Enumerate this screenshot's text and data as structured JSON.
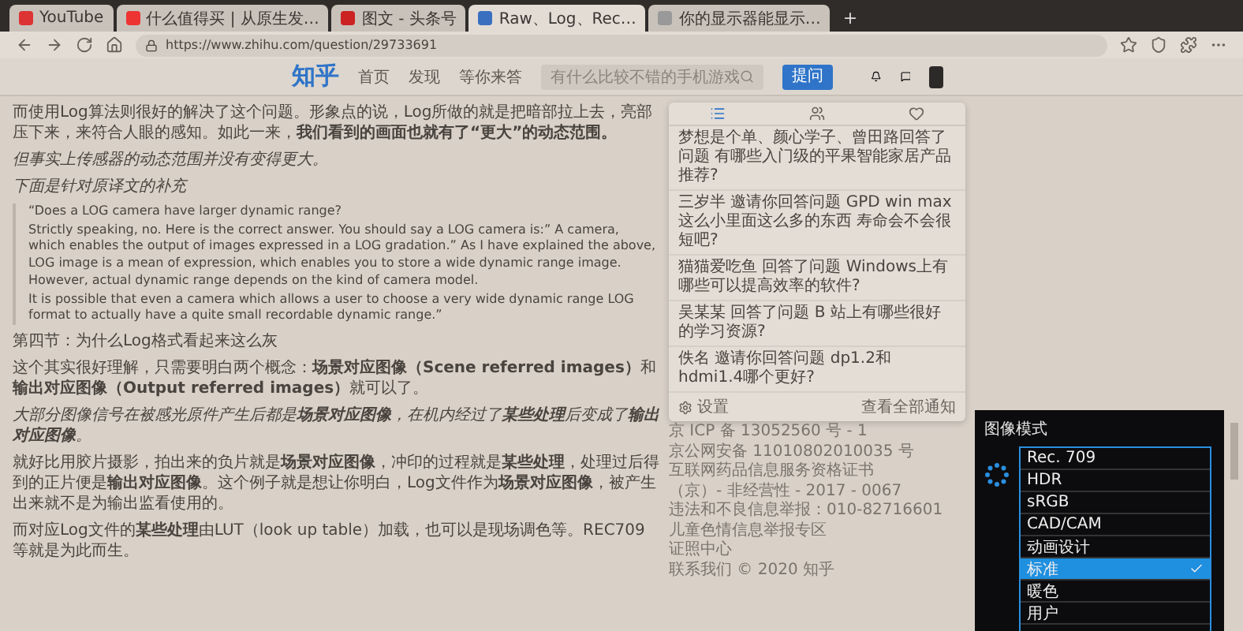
{
  "browser": {
    "tabs": [
      {
        "title": "YouTube",
        "selected": false
      },
      {
        "title": "什么值得买 | 从原生发…",
        "selected": false
      },
      {
        "title": "图文 - 头条号",
        "selected": false
      },
      {
        "title": "Raw、Log、Rec…",
        "selected": true
      },
      {
        "title": "你的显示器能显示…",
        "selected": false
      }
    ],
    "new_tab": "+",
    "url": "https://www.zhihu.com/question/29733691"
  },
  "header": {
    "logo": "知乎",
    "nav": [
      {
        "label": "首页"
      },
      {
        "label": "发现"
      },
      {
        "label": "等你来答"
      }
    ],
    "search": {
      "placeholder": "有什么比较不错的手机游戏"
    },
    "ask_button": "提问"
  },
  "article": [
    {
      "kind": "text",
      "text": "而使用Log算法则很好的解决了这个问题。形象点的说，Log所做的就是把暗部拉上去，亮部压下来，来符合人眼的感知。如此一来，**我们看到的画面也就有了“更大”的动态范围。**"
    },
    {
      "kind": "italic",
      "text": "但事实上传感器的动态范围并没有变得更大。"
    },
    {
      "kind": "italic",
      "text": "下面是针对原译文的补充"
    },
    {
      "kind": "quote",
      "lines": [
        "“Does a LOG camera have larger dynamic range?",
        "Strictly speaking, no. Here is the correct answer. You should say a LOG camera is:” A camera, which enables the output of images expressed in a LOG gradation.” As I have explained the above, LOG image is a mean of expression, which enables you to store a wide dynamic range image.",
        "However, actual dynamic range depends on the kind of camera model.",
        "It is possible that even a camera which allows a user to choose a very wide dynamic range LOG format to actually have a quite small recordable dynamic range.”"
      ]
    },
    {
      "kind": "heading",
      "text": "第四节：为什么Log格式看起来这么灰"
    },
    {
      "kind": "text",
      "text": "这个其实很好理解，只需要明白两个概念：**场景对应图像（Scene referred images）**和**输出对应图像（Output referred images）**就可以了。"
    },
    {
      "kind": "italic",
      "text": "大部分图像信号在被感光原件产生后都是**场景对应图像**，在机内经过了**某些处理**后变成了**输出对应图像**。"
    },
    {
      "kind": "text",
      "text": "就好比用胶片摄影，拍出来的负片就是**场景对应图像**，冲印的过程就是**某些处理**，处理过后得到的正片便是**输出对应图像**。这个例子就是想让你明白，Log文件作为**场景对应图像**，被产生出来就不是为输出监看使用的。"
    },
    {
      "kind": "text",
      "text": "而对应Log文件的**某些处理**由LUT（look up table）加载，也可以是现场调色等。REC709等就是为此而生。"
    }
  ],
  "notifications": {
    "tabs": [
      {
        "kind": "list",
        "selected": true
      },
      {
        "kind": "users",
        "selected": false
      },
      {
        "kind": "heart",
        "selected": false
      }
    ],
    "items": [
      "梦想是个单、颜心学子、曾田路回答了问题 有哪些入门级的平果智能家居产品推荐?",
      "三岁半 邀请你回答问题 GPD win max这么小里面这么多的东西 寿命会不会很短吧?",
      "猫猫爱吃鱼 回答了问题 Windows上有哪些可以提高效率的软件?",
      "吴某某 回答了问题 B 站上有哪些很好的学习资源?",
      "佚名 邀请你回答问题 dp1.2和hdmi1.4哪个更好?"
    ],
    "settings": "设置",
    "view_all": "查看全部通知"
  },
  "footer": [
    "京 ICP 备 13052560 号 - 1",
    "京公网安备 11010802010035 号",
    "互联网药品信息服务资格证书",
    "（京）- 非经营性 - 2017 - 0067",
    "违法和不良信息举报：010-82716601",
    "儿童色情信息举报专区",
    "证照中心",
    "联系我们 © 2020 知乎"
  ],
  "osd": {
    "title": "图像模式",
    "items": [
      {
        "label": "Rec. 709",
        "selected": false
      },
      {
        "label": "HDR",
        "selected": false
      },
      {
        "label": "sRGB",
        "selected": false
      },
      {
        "label": "CAD/CAM",
        "selected": false
      },
      {
        "label": "动画设计",
        "selected": false
      },
      {
        "label": "标准",
        "selected": true
      },
      {
        "label": "暖色",
        "selected": false
      },
      {
        "label": "用户",
        "selected": false
      }
    ]
  }
}
